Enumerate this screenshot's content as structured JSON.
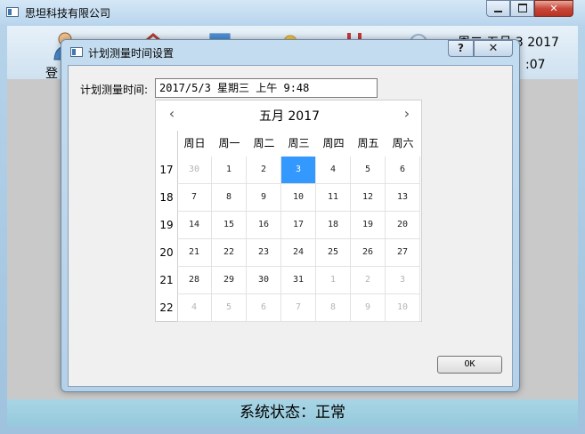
{
  "main_window": {
    "title": "思坦科技有限公司",
    "toolbar": {
      "login_label": "登",
      "icons": [
        "user-icon",
        "home-icon",
        "document-icon",
        "weather-icon",
        "tools-icon",
        "search-icon"
      ]
    },
    "clock_date": "周二  五月  3 2017",
    "clock_time": ":07",
    "status_text": "系统状态：正常"
  },
  "dialog": {
    "title": "计划测量时间设置",
    "help_label": "?",
    "close_label": "✕",
    "field_label": "计划测量时间:",
    "field_value": "2017/5/3 星期三 上午 9:48",
    "ok_label": "OK"
  },
  "calendar": {
    "month_label": "五月  2017",
    "prev_label": "‹",
    "next_label": "›",
    "weekdays": [
      "周日",
      "周一",
      "周二",
      "周三",
      "周四",
      "周五",
      "周六"
    ],
    "week_numbers": [
      "17",
      "18",
      "19",
      "20",
      "21",
      "22"
    ],
    "weeks": [
      [
        {
          "d": "30",
          "m": "prev"
        },
        {
          "d": "1"
        },
        {
          "d": "2"
        },
        {
          "d": "3",
          "sel": true
        },
        {
          "d": "4"
        },
        {
          "d": "5"
        },
        {
          "d": "6"
        }
      ],
      [
        {
          "d": "7"
        },
        {
          "d": "8"
        },
        {
          "d": "9"
        },
        {
          "d": "10"
        },
        {
          "d": "11"
        },
        {
          "d": "12"
        },
        {
          "d": "13"
        }
      ],
      [
        {
          "d": "14"
        },
        {
          "d": "15"
        },
        {
          "d": "16"
        },
        {
          "d": "17"
        },
        {
          "d": "18"
        },
        {
          "d": "19"
        },
        {
          "d": "20"
        }
      ],
      [
        {
          "d": "21"
        },
        {
          "d": "22"
        },
        {
          "d": "23"
        },
        {
          "d": "24"
        },
        {
          "d": "25"
        },
        {
          "d": "26"
        },
        {
          "d": "27"
        }
      ],
      [
        {
          "d": "28"
        },
        {
          "d": "29"
        },
        {
          "d": "30"
        },
        {
          "d": "31"
        },
        {
          "d": "1",
          "m": "next"
        },
        {
          "d": "2",
          "m": "next"
        },
        {
          "d": "3",
          "m": "next"
        }
      ],
      [
        {
          "d": "4",
          "m": "next"
        },
        {
          "d": "5",
          "m": "next"
        },
        {
          "d": "6",
          "m": "next"
        },
        {
          "d": "7",
          "m": "next"
        },
        {
          "d": "8",
          "m": "next"
        },
        {
          "d": "9",
          "m": "next"
        },
        {
          "d": "10",
          "m": "next"
        }
      ]
    ],
    "selected_color": "#3399ff"
  }
}
